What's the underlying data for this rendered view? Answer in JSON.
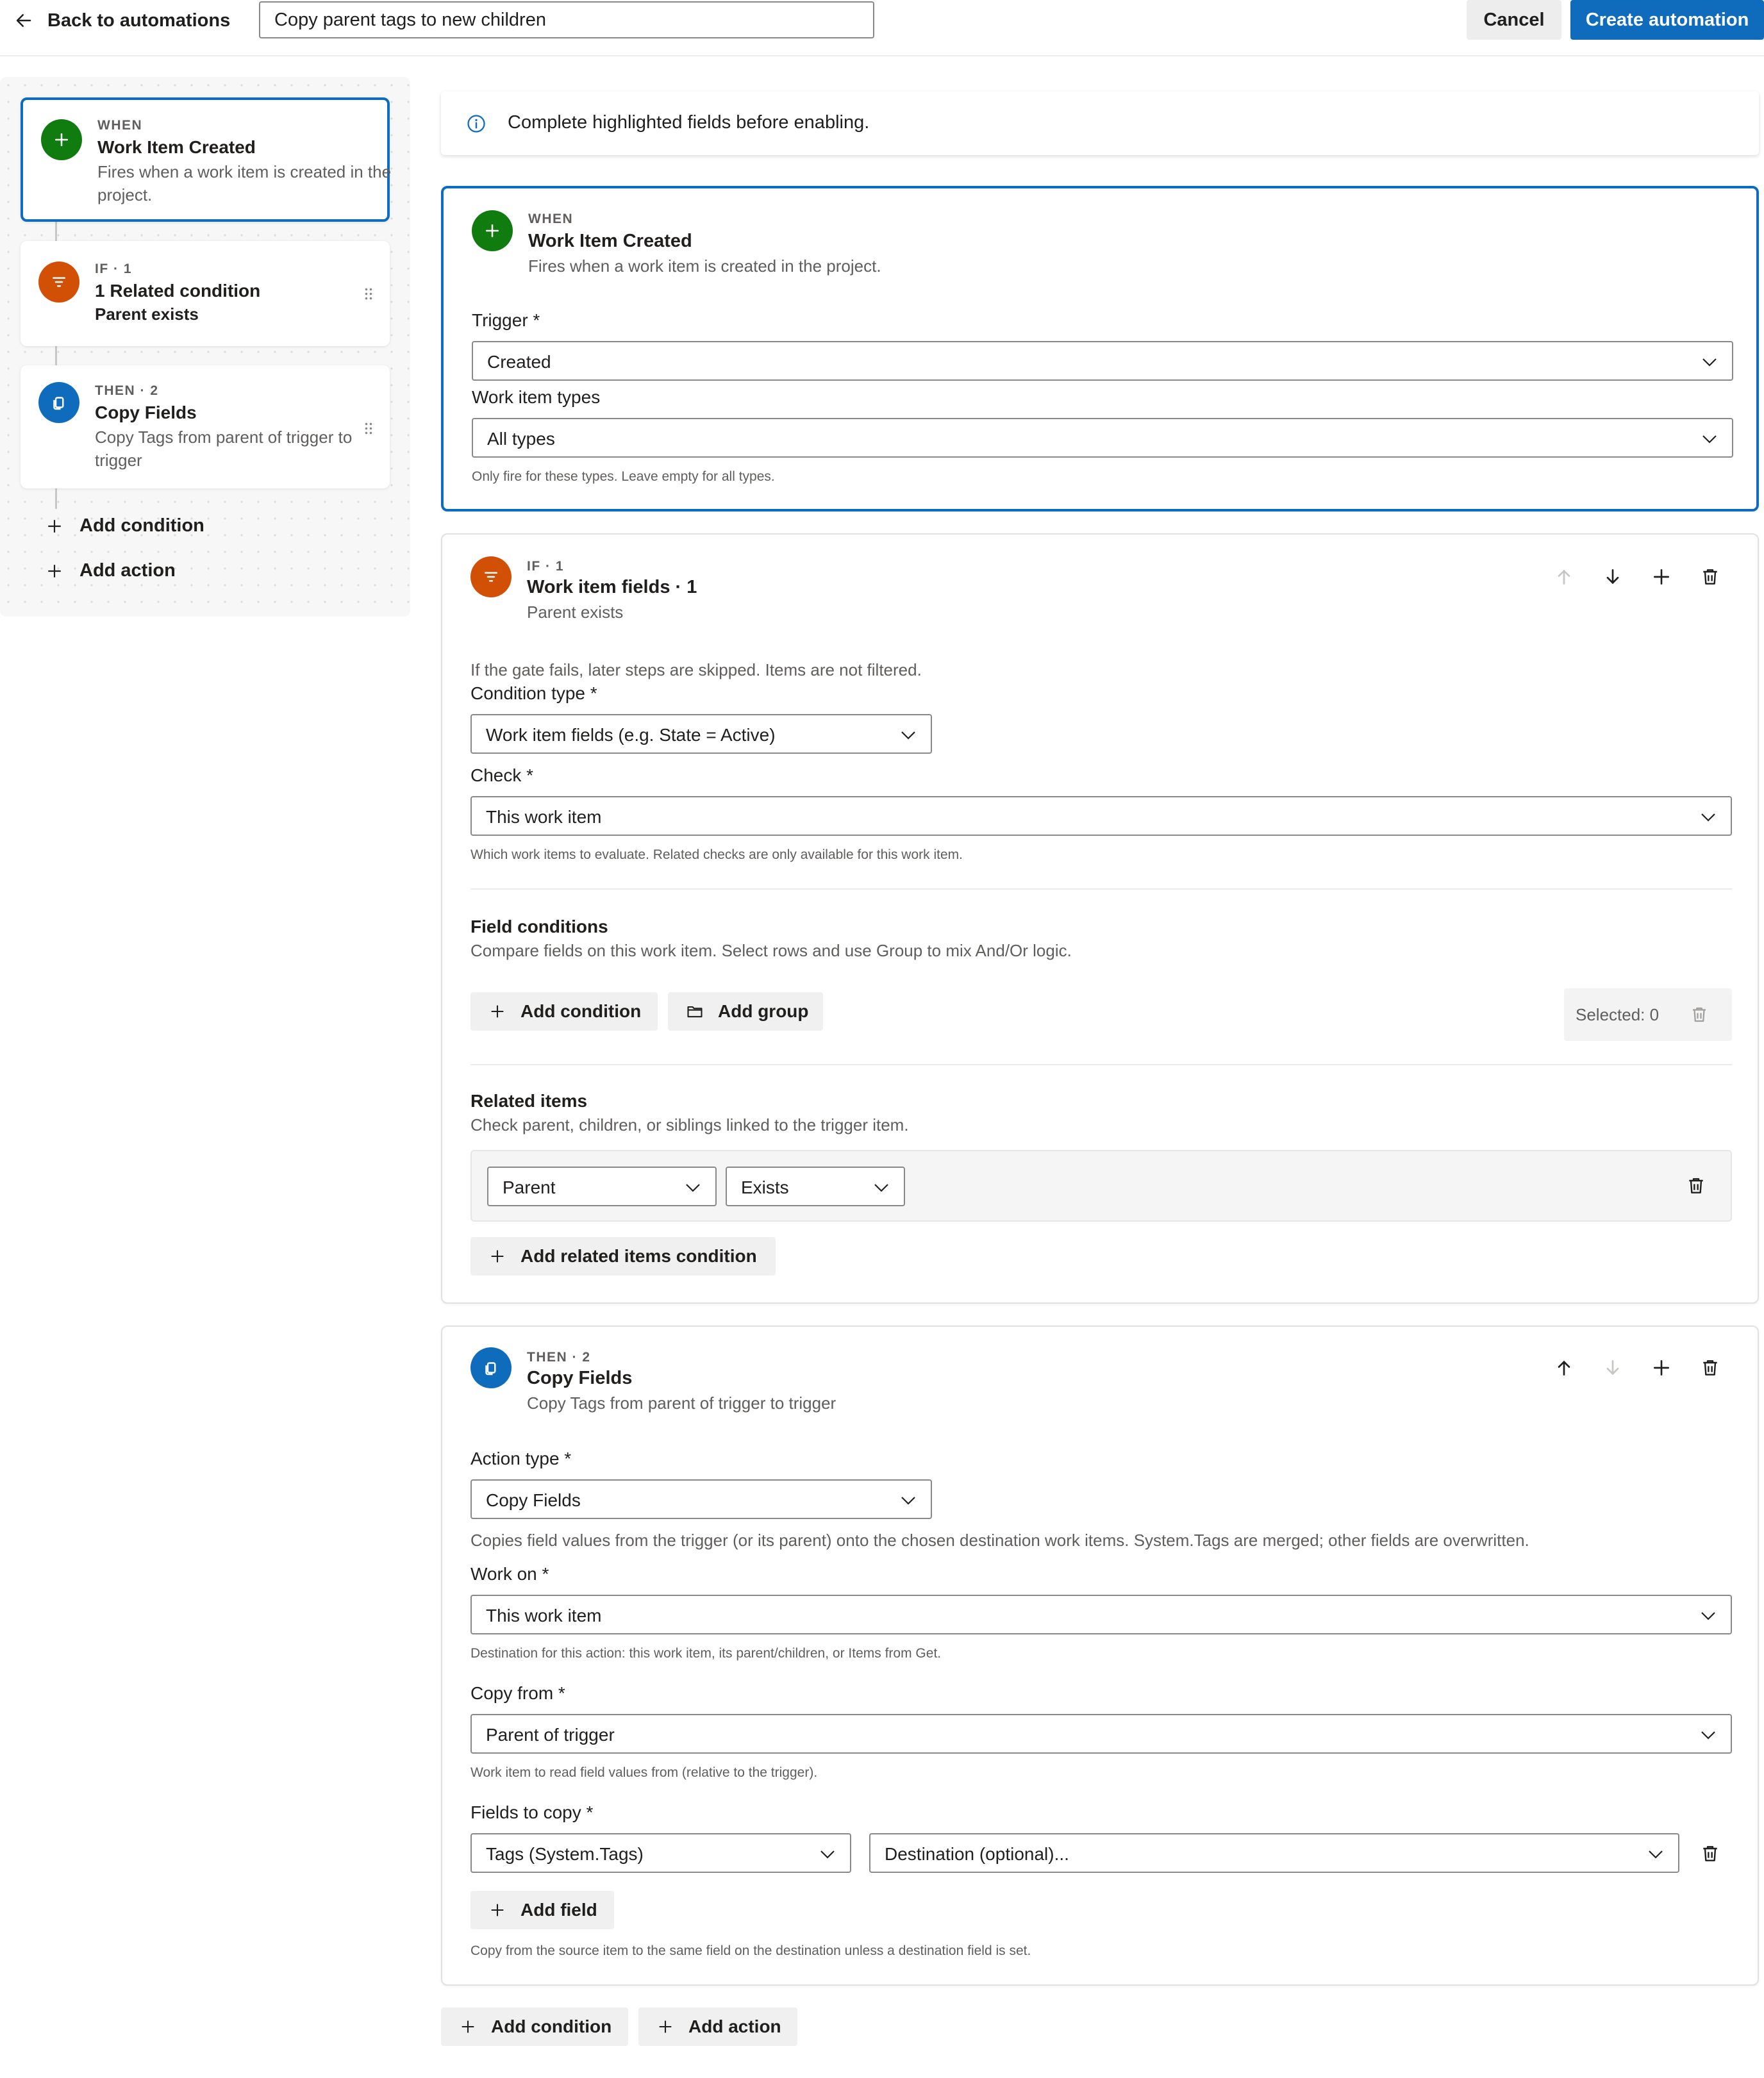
{
  "header": {
    "back_label": "Back to automations",
    "automation_name": "Copy parent tags to new children",
    "cancel_label": "Cancel",
    "create_label": "Create automation"
  },
  "sidebar": {
    "steps": [
      {
        "eyebrow": "WHEN",
        "title": "Work Item Created",
        "subtitle": "Fires when a work item is created in the project.",
        "icon": "plus-icon",
        "color": "#107c10"
      },
      {
        "eyebrow": "IF · 1",
        "title": "1 Related condition",
        "subtitle": "Parent exists",
        "icon": "filter-icon",
        "color": "#d24f06"
      },
      {
        "eyebrow": "THEN · 2",
        "title": "Copy Fields",
        "subtitle": "Copy Tags from parent of trigger to trigger",
        "icon": "copy-icon",
        "color": "#0f6cbd"
      }
    ],
    "add_condition_label": "Add condition",
    "add_action_label": "Add action"
  },
  "banner": {
    "text": "Complete highlighted fields before enabling.",
    "icon": "info-icon"
  },
  "trigger_card": {
    "eyebrow": "WHEN",
    "title": "Work Item Created",
    "subtitle": "Fires when a work item is created in the project.",
    "trigger_label": "Trigger *",
    "trigger_value": "Created",
    "types_label": "Work item types",
    "types_value": "All types",
    "types_help": "Only fire for these types. Leave empty for all types."
  },
  "condition_card": {
    "eyebrow": "IF · 1",
    "title": "Work item fields · 1",
    "subtitle": "Parent exists",
    "gate_note": "If the gate fails, later steps are skipped. Items are not filtered.",
    "condition_type_label": "Condition type *",
    "condition_type_value": "Work item fields (e.g. State = Active)",
    "check_label": "Check *",
    "check_value": "This work item",
    "check_help": "Which work items to evaluate. Related checks are only available for this work item.",
    "field_conditions_title": "Field conditions",
    "field_conditions_desc": "Compare fields on this work item. Select rows and use Group to mix And/Or logic.",
    "add_condition_label": "Add condition",
    "add_group_label": "Add group",
    "selected_label": "Selected: 0",
    "related_title": "Related items",
    "related_desc": "Check parent, children, or siblings linked to the trigger item.",
    "related_relation": "Parent",
    "related_operator": "Exists",
    "add_related_label": "Add related items condition"
  },
  "action_card": {
    "eyebrow": "THEN · 2",
    "title": "Copy Fields",
    "subtitle": "Copy Tags from parent of trigger to trigger",
    "action_type_label": "Action type *",
    "action_type_value": "Copy Fields",
    "action_note": "Copies field values from the trigger (or its parent) onto the chosen destination work items. System.Tags are merged; other fields are overwritten.",
    "work_on_label": "Work on *",
    "work_on_value": "This work item",
    "work_on_help": "Destination for this action: this work item, its parent/children, or Items from Get.",
    "copy_from_label": "Copy from *",
    "copy_from_value": "Parent of trigger",
    "copy_from_help": "Work item to read field values from (relative to the trigger).",
    "fields_label": "Fields to copy *",
    "field_source": "Tags (System.Tags)",
    "field_destination": "Destination (optional)...",
    "add_field_label": "Add field",
    "fields_help": "Copy from the source item to the same field on the destination unless a destination field is set."
  },
  "footer": {
    "add_condition_label": "Add condition",
    "add_action_label": "Add action"
  }
}
